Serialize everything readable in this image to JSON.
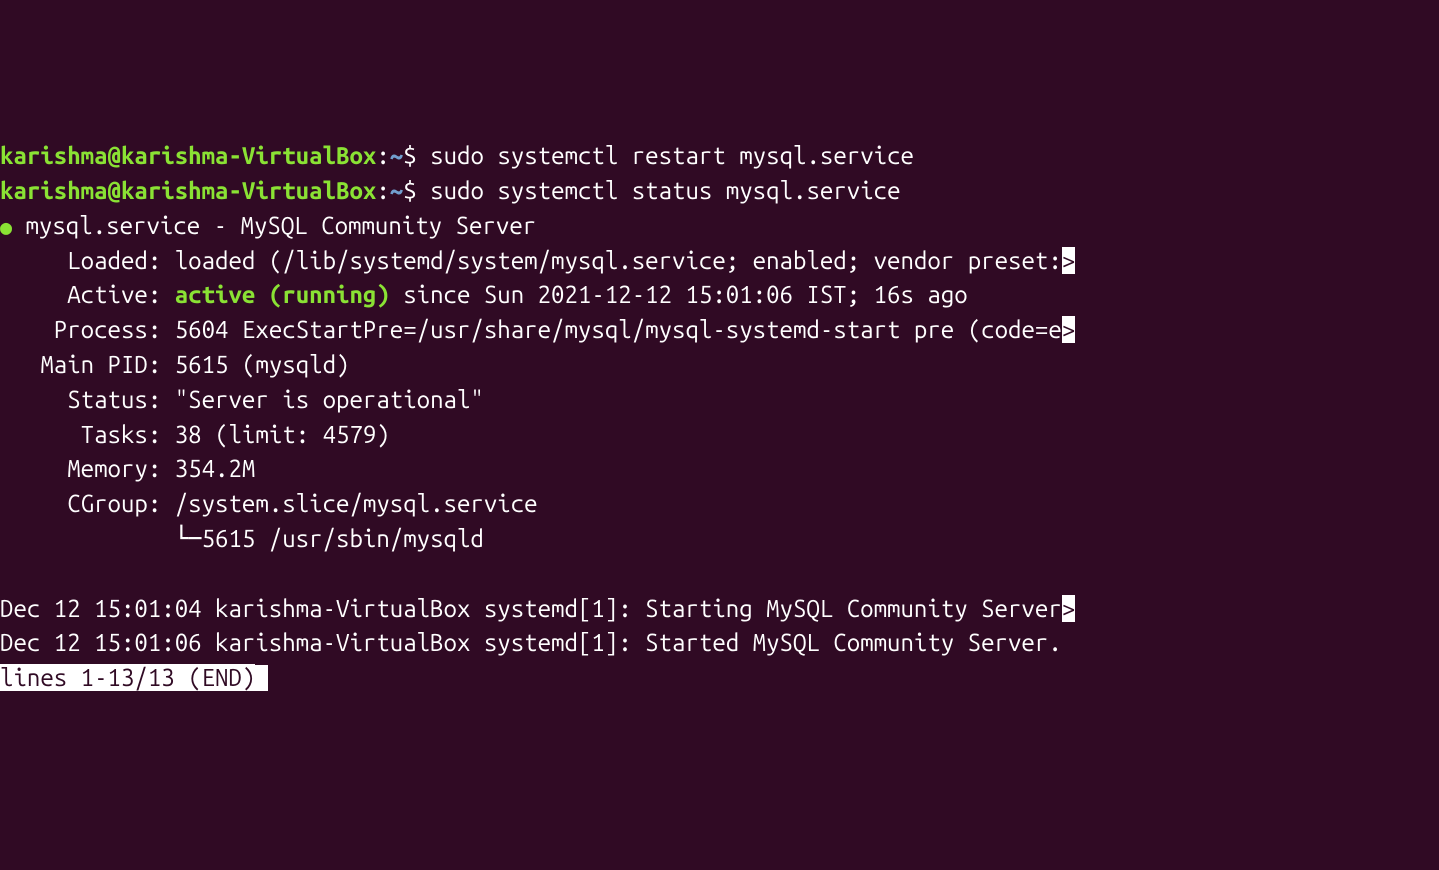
{
  "prompt": {
    "user_host": "karishma@karishma-VirtualBox",
    "path": "~",
    "sign": "$",
    "colon": ":"
  },
  "commands": {
    "cmd1": " sudo systemctl restart mysql.service",
    "cmd2": " sudo systemctl status mysql.service"
  },
  "status": {
    "service_line": " mysql.service - MySQL Community Server",
    "loaded_label": "     Loaded: ",
    "loaded_value": "loaded (/lib/systemd/system/mysql.service; enabled; vendor preset:",
    "loaded_overflow": ">",
    "active_label": "     Active: ",
    "active_state": "active (running)",
    "active_since": " since Sun 2021-12-12 15:01:06 IST; 16s ago",
    "process_label": "    Process: ",
    "process_value": "5604 ExecStartPre=/usr/share/mysql/mysql-systemd-start pre (code=e",
    "process_overflow": ">",
    "mainpid_label": "   Main PID: ",
    "mainpid_value": "5615 (mysqld)",
    "status_label": "     Status: ",
    "status_value": "\"Server is operational\"",
    "tasks_label": "      Tasks: ",
    "tasks_value": "38 (limit: 4579)",
    "memory_label": "     Memory: ",
    "memory_value": "354.2M",
    "cgroup_label": "     CGroup: ",
    "cgroup_value": "/system.slice/mysql.service",
    "cgroup_child": "             └─5615 /usr/sbin/mysqld"
  },
  "log": {
    "line1": "Dec 12 15:01:04 karishma-VirtualBox systemd[1]: Starting MySQL Community Server",
    "line1_overflow": ">",
    "line2": "Dec 12 15:01:06 karishma-VirtualBox systemd[1]: Started MySQL Community Server."
  },
  "pager": {
    "status": "lines 1-13/13 (END)"
  }
}
